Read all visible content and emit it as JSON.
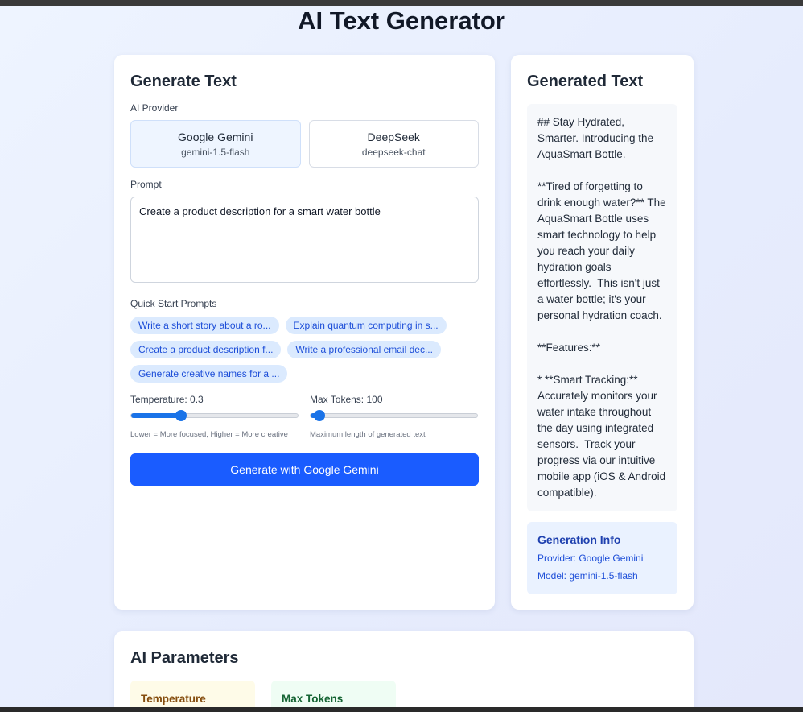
{
  "page": {
    "title": "AI Text Generator"
  },
  "generate": {
    "title": "Generate Text",
    "provider_label": "AI Provider",
    "providers": [
      {
        "name": "Google Gemini",
        "model": "gemini-1.5-flash",
        "selected": true
      },
      {
        "name": "DeepSeek",
        "model": "deepseek-chat",
        "selected": false
      }
    ],
    "prompt_label": "Prompt",
    "prompt_value": "Create a product description for a smart water bottle",
    "quick_label": "Quick Start Prompts",
    "quick_prompts": [
      "Write a short story about a ro...",
      "Explain quantum computing in s...",
      "Create a product description f...",
      "Write a professional email dec...",
      "Generate creative names for a ..."
    ],
    "temperature": {
      "label": "Temperature: 0.3",
      "value": 0.3,
      "min": 0,
      "max": 1,
      "hint": "Lower = More focused, Higher = More creative"
    },
    "max_tokens": {
      "label": "Max Tokens: 100",
      "value": 100,
      "min": 50,
      "max": 1000,
      "hint": "Maximum length of generated text"
    },
    "button_label": "Generate with Google Gemini"
  },
  "output": {
    "title": "Generated Text",
    "text": "## Stay Hydrated, Smarter. Introducing the AquaSmart Bottle.\n\n**Tired of forgetting to drink enough water?** The AquaSmart Bottle uses smart technology to help you reach your daily hydration goals effortlessly.  This isn't just a water bottle; it's your personal hydration coach.\n\n**Features:**\n\n* **Smart Tracking:** Accurately monitors your water intake throughout the day using integrated sensors.  Track your progress via our intuitive mobile app (iOS & Android compatible).",
    "info_title": "Generation Info",
    "info_provider": "Provider: Google Gemini",
    "info_model": "Model: gemini-1.5-flash"
  },
  "parameters": {
    "title": "AI Parameters",
    "temperature_label": "Temperature",
    "max_tokens_label": "Max Tokens"
  },
  "colors": {
    "accent": "#1a5cff",
    "slider": "#1a73e8",
    "chip_bg": "#dbeafe",
    "chip_text": "#1d4ed8"
  }
}
